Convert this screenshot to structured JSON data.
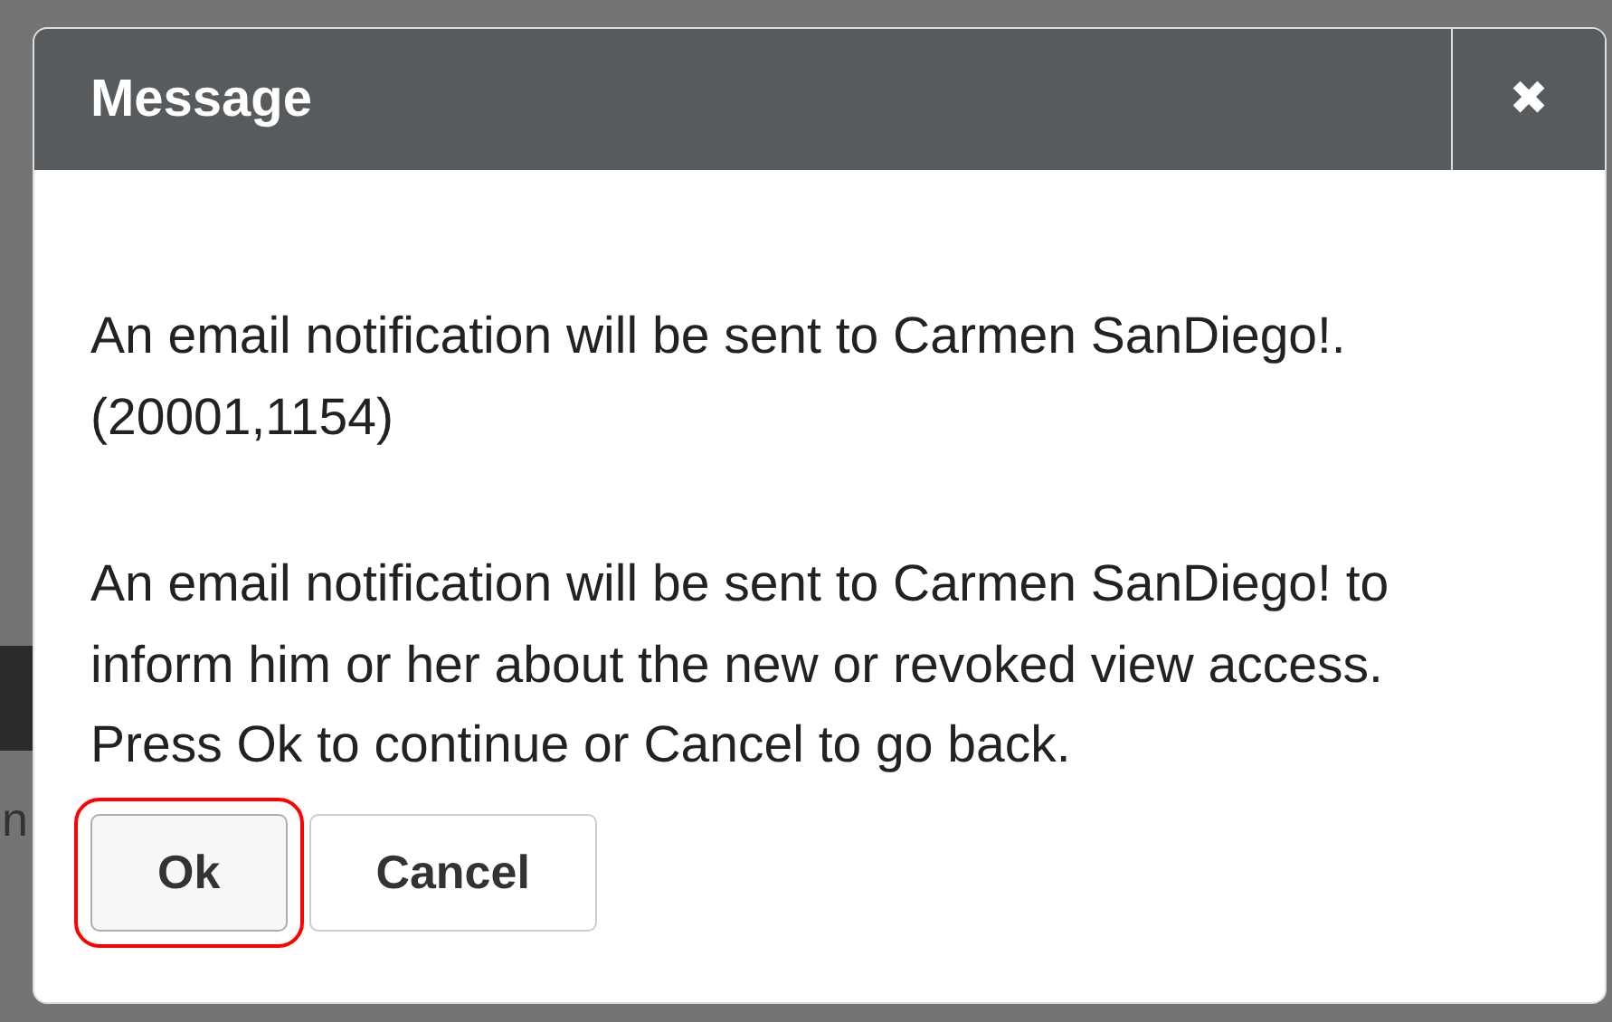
{
  "background": {
    "text_fragment": "n"
  },
  "dialog": {
    "title": "Message",
    "close": "✖",
    "paragraphs": [
      "An email notification will be sent to Carmen SanDiego!. (20001,1154)",
      "An email notification will be sent to Carmen SanDiego! to inform him or her about the new or revoked view access. Press Ok to continue or Cancel to go back."
    ],
    "buttons": [
      {
        "label": "Ok",
        "focused": true
      },
      {
        "label": "Cancel",
        "focused": false
      }
    ]
  }
}
